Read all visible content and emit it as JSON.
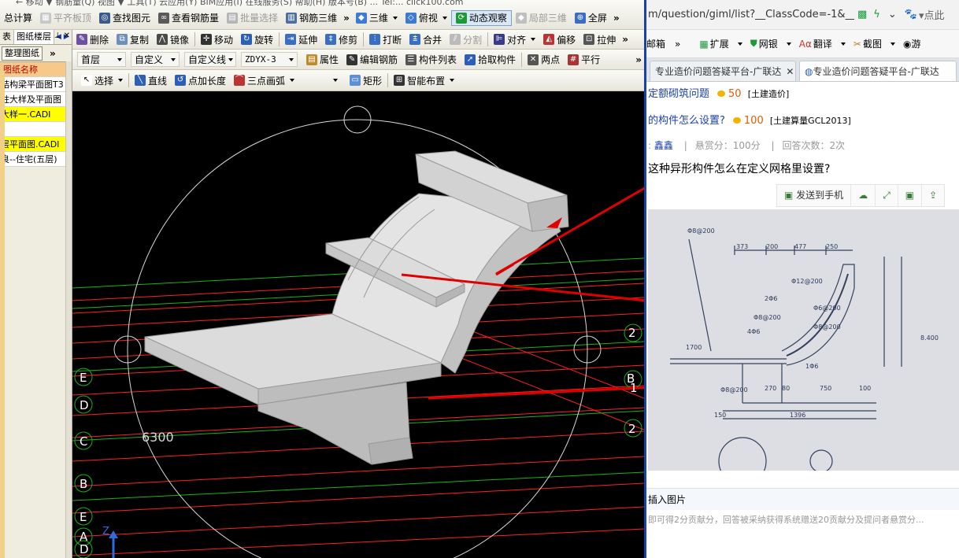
{
  "toolbar1": {
    "items": [
      "总计算",
      "平齐板顶",
      "查找图元",
      "查看钢筋量",
      "批量选择",
      "钢筋三维",
      "三维",
      "俯视",
      "动态观察",
      "局部三维",
      "全屏"
    ],
    "top_cut": "← 移动 ▼  钢筋量(Q)  视图 ▼  工具(T)  云应用(Y)  BIM应用(I)  在线服务(S)  帮助(H)  版本号(B)  ...  Tel:... click100.com"
  },
  "toolbar2": {
    "items": [
      "删除",
      "复制",
      "镜像",
      "移动",
      "旋转",
      "延伸",
      "修剪",
      "打断",
      "合并",
      "分割",
      "对齐",
      "偏移",
      "拉伸"
    ]
  },
  "toolbar3": {
    "floor": "首层",
    "custom": "自定义",
    "custom_line": "自定义线",
    "code": "ZDYX-3",
    "items": [
      "属性",
      "编辑钢筋",
      "构件列表",
      "拾取构件",
      "两点",
      "平行"
    ]
  },
  "toolbar4": {
    "items": [
      "选择",
      "直线",
      "点加长度",
      "三点画弧",
      "矩形",
      "智能布置"
    ]
  },
  "left_panel": {
    "tabs": [
      "表",
      "图纸楼层"
    ],
    "organize_button": "整理图纸",
    "header": "图纸名称",
    "rows": [
      "结构梁平面图T3",
      "柱大样及平面图",
      "大样一.CADI",
      "",
      "层平面图.CADI",
      "良--住宅(五层)"
    ]
  },
  "viewport": {
    "dimension_label": "6300",
    "axis_labels_left": [
      "E",
      "D",
      "C",
      "B",
      "E",
      "A",
      "D"
    ],
    "axis_labels_right": [
      "2",
      "B",
      "1",
      "2"
    ],
    "z_axis": "Z"
  },
  "browser": {
    "address": "m/question/giml/list?__ClassCode=-1&__I",
    "bookmarks": [
      "邮箱",
      "扩展",
      "网银",
      "翻译",
      "截图",
      "游"
    ],
    "tabs": [
      "专业造价问题答疑平台-广联达",
      "专业造价问题答疑平台-广联达"
    ],
    "q1_title": "定额砌筑问题",
    "q1_points": "50",
    "q1_tag": "[土建造价]",
    "q2_title": "的构件怎么设置?",
    "q2_points": "100",
    "q2_tag": "[土建算量GCL2013]",
    "user_prefix": ":",
    "user": "鑫鑫",
    "reward": "悬赏分：100分",
    "answers": "回答次数：2次",
    "question": "这种异形构件怎么在定义网格里设置?",
    "send_to_phone": "发送到手机",
    "insert_image": "插入图片",
    "footer_text": "即可得2分贡献分，回答被采纳获得系统赠送20贡献分及提问者悬赏分..."
  },
  "drawing": {
    "dims_top": [
      "373",
      "200",
      "477",
      "250"
    ],
    "dims_bottom": [
      "270",
      "80",
      "750",
      "100",
      "150",
      "1396"
    ],
    "labels": [
      "Φ8@200",
      "Φ12@200",
      "2Φ6",
      "Φ8@200",
      "Φ6@200",
      "4Φ6",
      "Φ8@200",
      "1700",
      "8.400",
      "1Φ6",
      "Φ8@200"
    ]
  },
  "colors": {
    "accent_blue": "#1b3fae",
    "arrow_red": "#e00000",
    "grid_red": "#ff2020",
    "grid_green": "#18b418",
    "active_tab": "#ffff00"
  }
}
